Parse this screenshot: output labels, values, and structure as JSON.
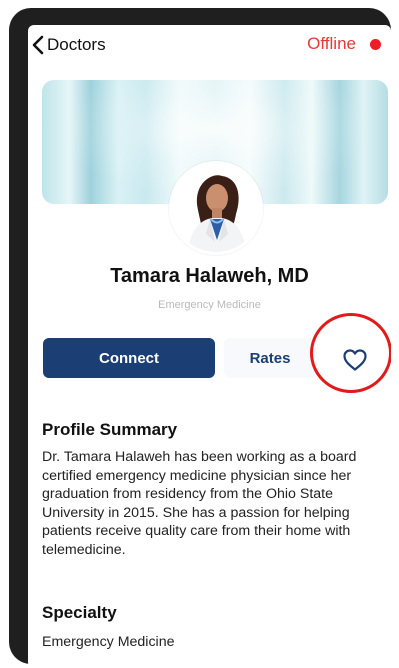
{
  "nav": {
    "back_label": "Doctors",
    "status_text": "Offline",
    "status_color": "#ee1c25"
  },
  "doctor": {
    "name": "Tamara Halaweh, MD",
    "specialty_subtitle": "Emergency Medicine"
  },
  "actions": {
    "connect_label": "Connect",
    "rates_label": "Rates",
    "favorite_icon": "heart-outline-icon"
  },
  "profile": {
    "title": "Profile Summary",
    "text": "Dr. Tamara Halaweh has been working as a board certified emergency medicine physician since her graduation from residency from the Ohio State University in 2015. She has a passion for helping patients receive quality care from their home with telemedicine."
  },
  "specialty": {
    "title": "Specialty",
    "value": "Emergency Medicine"
  },
  "colors": {
    "primary": "#1b3f75",
    "offline": "#e53935",
    "highlight": "#e01b1b"
  }
}
